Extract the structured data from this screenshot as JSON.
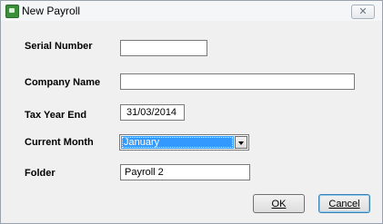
{
  "window": {
    "title": "New Payroll",
    "close_glyph": "✕"
  },
  "form": {
    "serial_number": {
      "label": "Serial Number",
      "value": ""
    },
    "company_name": {
      "label": "Company Name",
      "value": ""
    },
    "tax_year_end": {
      "label": "Tax Year End",
      "value": "31/03/2014"
    },
    "current_month": {
      "label": "Current Month",
      "value": "January"
    },
    "folder": {
      "label": "Folder",
      "value": "Payroll 2"
    }
  },
  "buttons": {
    "ok": "OK",
    "cancel": "Cancel"
  },
  "colors": {
    "selection": "#3399ff",
    "window_bg": "#f0f0f0"
  }
}
